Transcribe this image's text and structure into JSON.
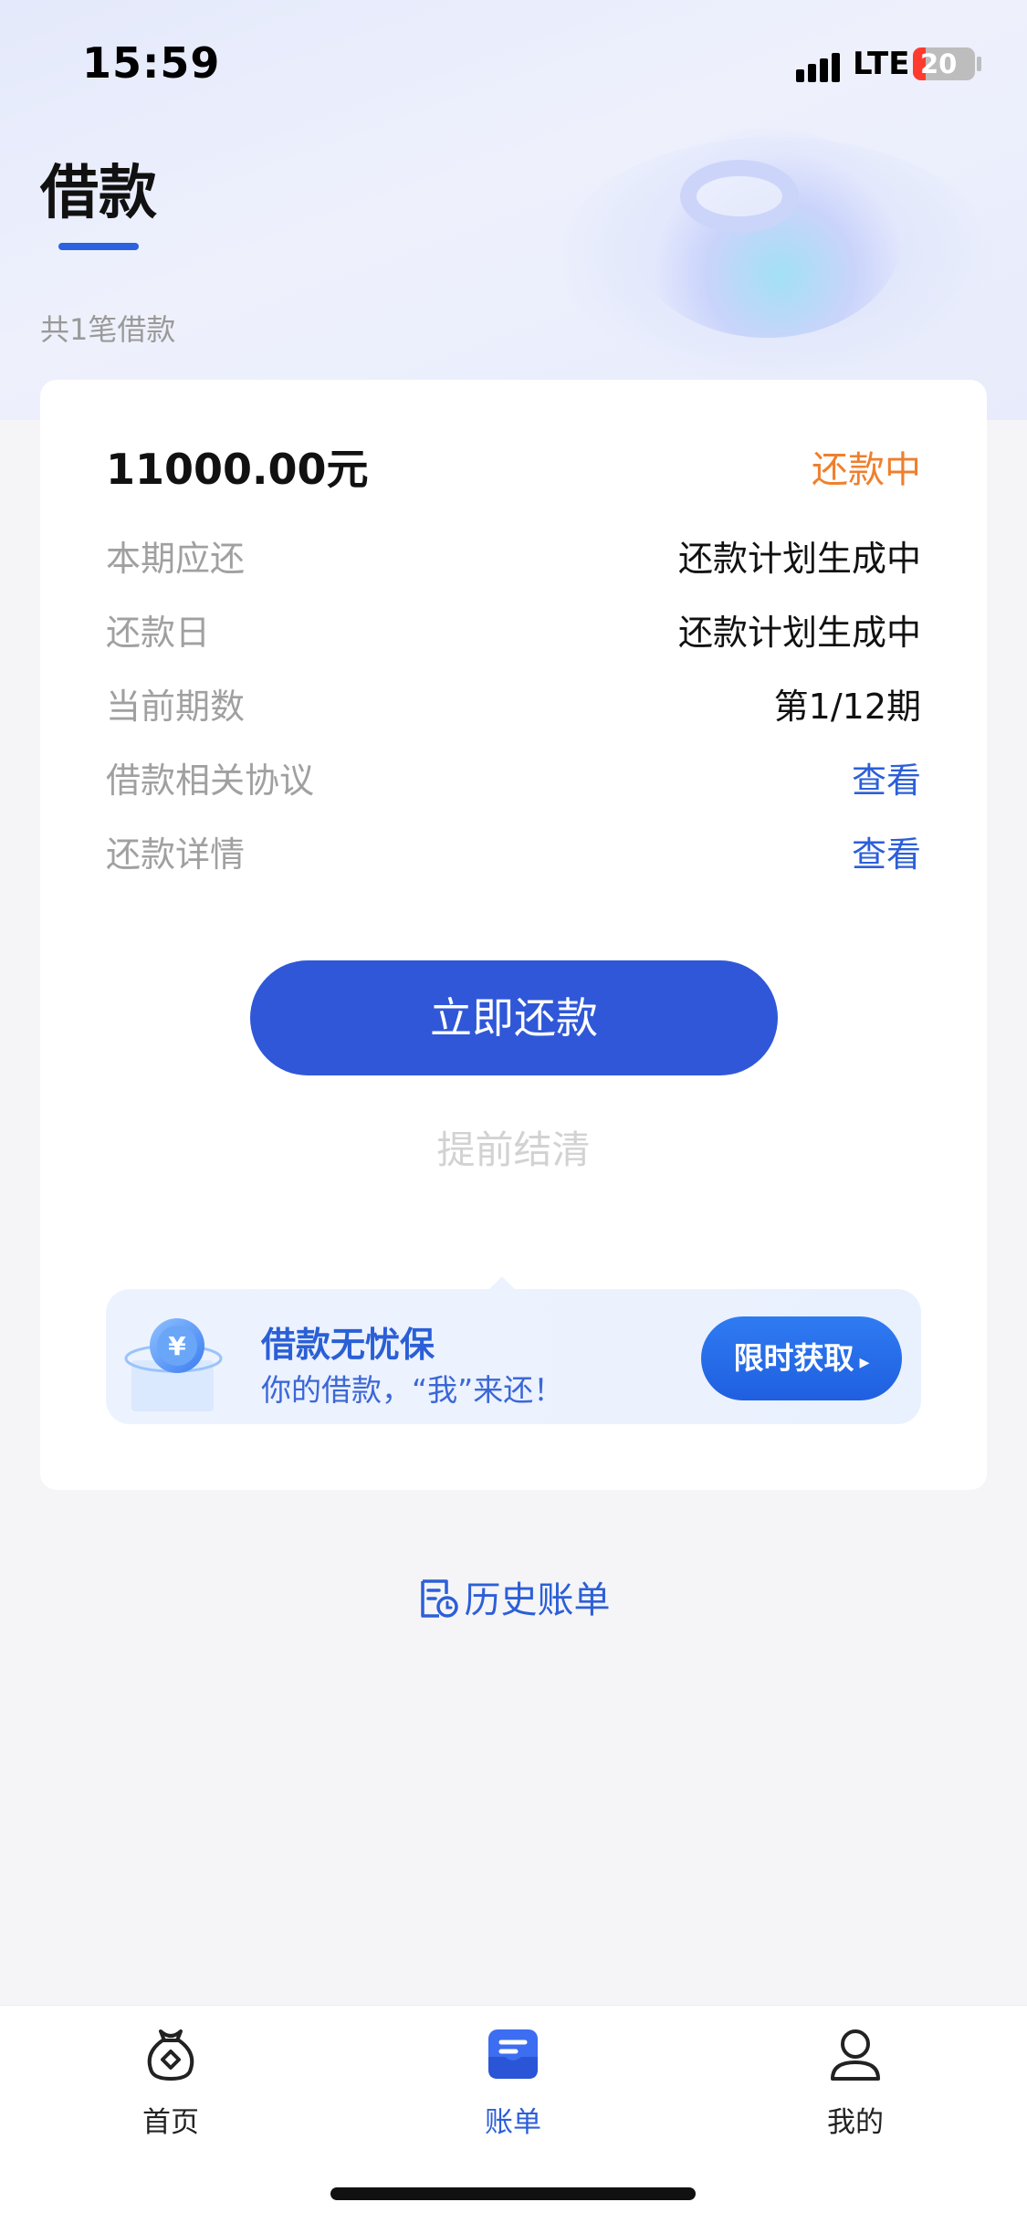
{
  "status_bar": {
    "time": "15:59",
    "network": "LTE",
    "battery": "20"
  },
  "header": {
    "title": "借款",
    "loan_count": "共1笔借款"
  },
  "loan_card": {
    "amount": "11000.00元",
    "status": "还款中",
    "rows": [
      {
        "label": "本期应还",
        "value": "还款计划生成中"
      },
      {
        "label": "还款日",
        "value": "还款计划生成中"
      },
      {
        "label": "当前期数",
        "value": "第1/12期"
      },
      {
        "label": "借款相关协议",
        "value": "查看"
      },
      {
        "label": "还款详情",
        "value": "查看"
      }
    ],
    "pay_button": "立即还款",
    "prepay_label": "提前结清"
  },
  "promo": {
    "title": "借款无忧保",
    "subtitle": "你的借款，“我”来还！",
    "button": "限时获取",
    "icon": "yuan-coin-icon"
  },
  "history": {
    "label": "历史账单",
    "icon": "bill-clock-icon"
  },
  "tabbar": {
    "items": [
      {
        "label": "首页",
        "icon": "money-bag-icon",
        "active": false
      },
      {
        "label": "账单",
        "icon": "bill-icon",
        "active": true
      },
      {
        "label": "我的",
        "icon": "user-icon",
        "active": false
      }
    ]
  },
  "colors": {
    "accent": "#2f57d8",
    "status_orange": "#f07f2c",
    "link_blue": "#2c5fd8"
  }
}
